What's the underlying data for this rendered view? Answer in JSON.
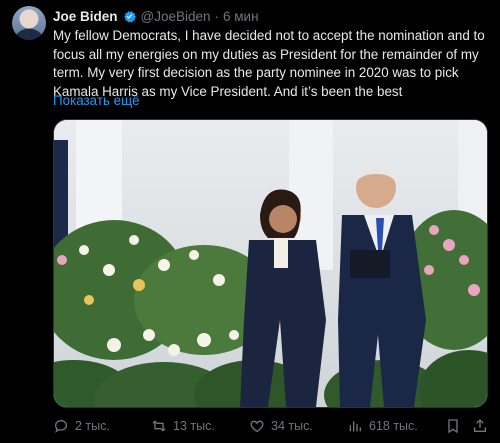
{
  "tweet": {
    "author_name": "Joe Biden",
    "handle": "@JoeBiden",
    "separator": "·",
    "time": "6 мин",
    "text": "My fellow Democrats, I have decided not to accept the nomination and to focus all my energies on my duties as President for the remainder of my term. My very first decision as the party nominee in 2020 was to pick Kamala Harris as my Vice President. And it’s been the best",
    "show_more": "Показать ещё"
  },
  "actions": {
    "replies": "2 тыс.",
    "retweets": "13 тыс.",
    "likes": "34 тыс.",
    "views": "618 тыс."
  },
  "colors": {
    "background": "#000000",
    "text": "#e7e9ea",
    "muted": "#71767b",
    "accent": "#1d9bf0"
  },
  "icons": [
    "verified-badge-icon",
    "reply-icon",
    "retweet-icon",
    "like-icon",
    "views-icon",
    "bookmark-icon",
    "share-icon"
  ]
}
